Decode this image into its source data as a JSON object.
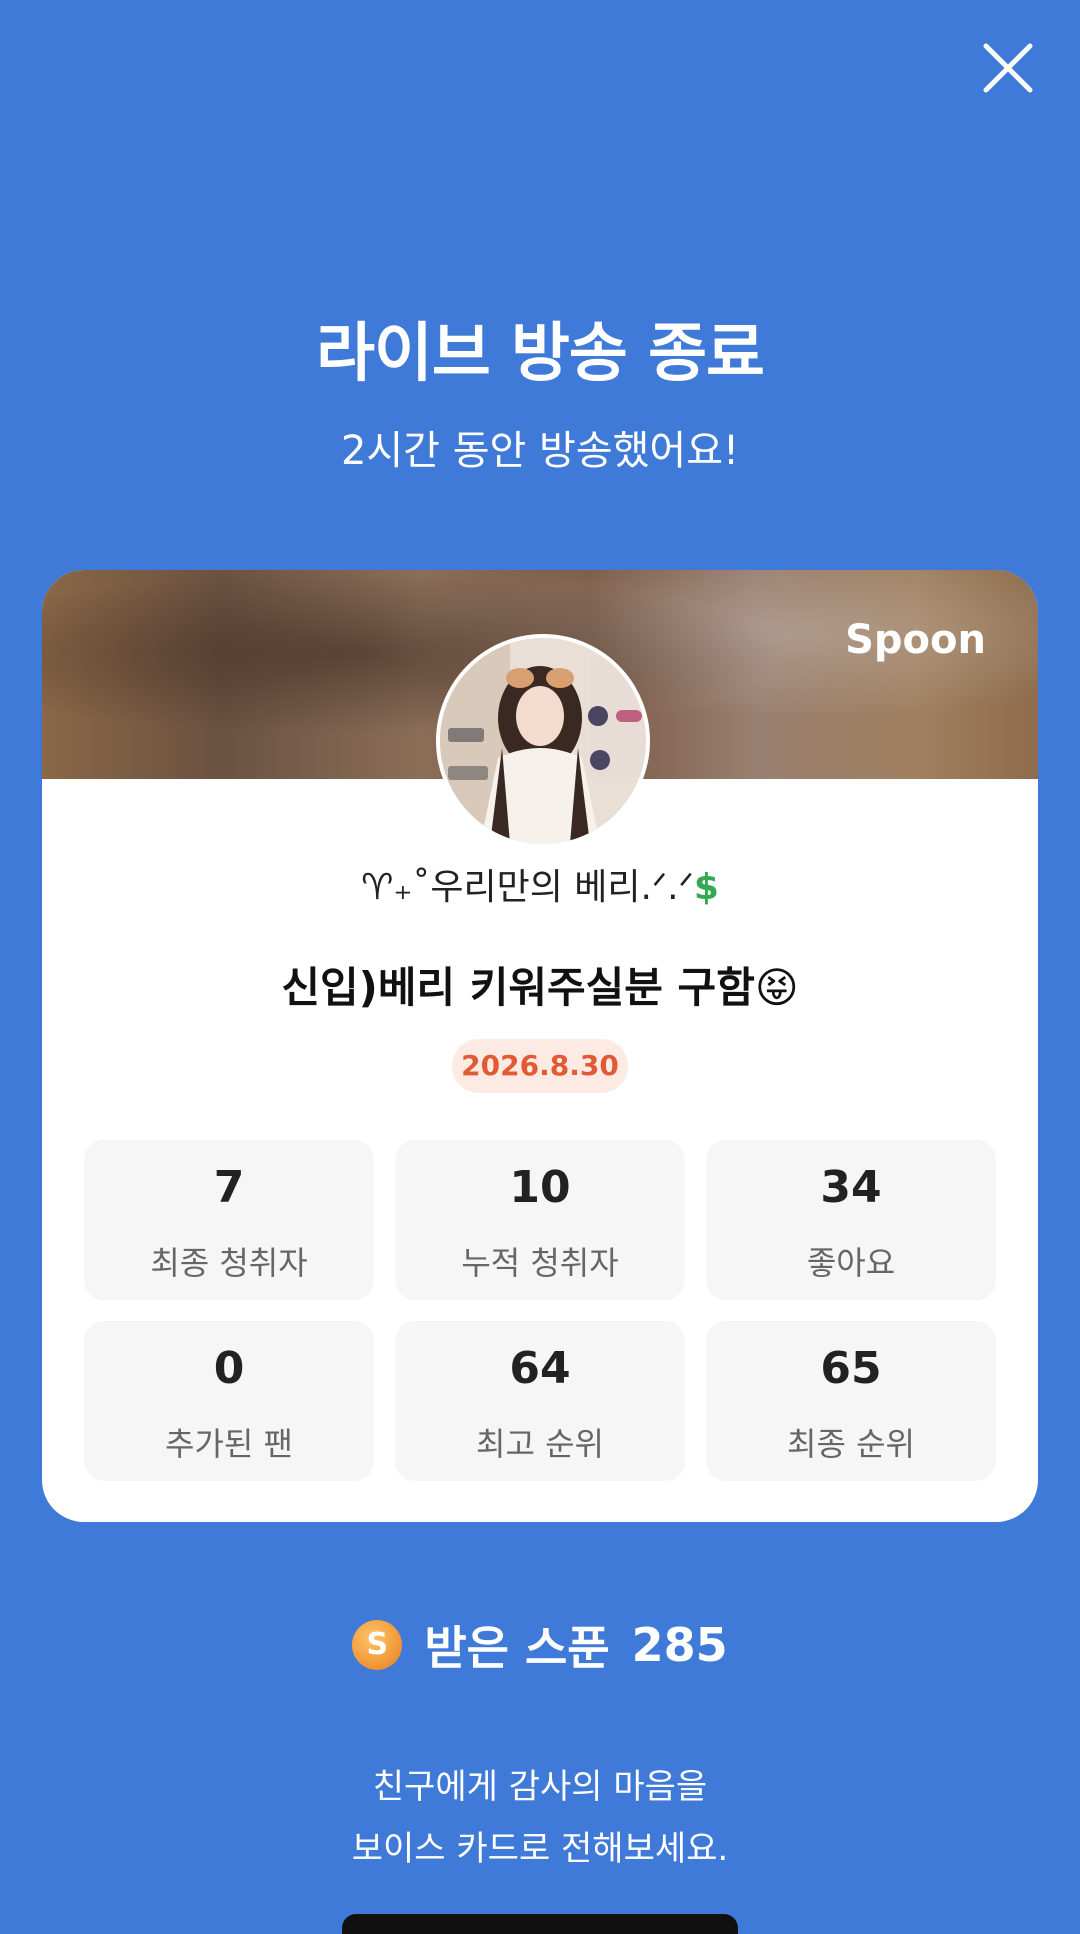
{
  "header": {
    "title": "라이브 방송 종료",
    "subtitle": "2시간 동안 방송했어요!"
  },
  "card": {
    "brand": "Spoon",
    "nickname_prefix": "♈₊˚우리만의 베리.ᐟ.ᐟ",
    "nickname_suffix": "$",
    "live_title": "신입)베리 키워주실분 구함😝",
    "date": "2026.8.30",
    "stats": [
      {
        "value": "7",
        "label": "최종 청취자"
      },
      {
        "value": "10",
        "label": "누적 청취자"
      },
      {
        "value": "34",
        "label": "좋아요"
      },
      {
        "value": "0",
        "label": "추가된 팬"
      },
      {
        "value": "64",
        "label": "최고 순위"
      },
      {
        "value": "65",
        "label": "최종 순위"
      }
    ]
  },
  "spoons": {
    "icon_letter": "S",
    "label": "받은 스푼",
    "count": "285"
  },
  "thanks": {
    "line1": "친구에게 감사의 마음을",
    "line2": "보이스 카드로 전해보세요."
  },
  "colors": {
    "background": "#407ad8",
    "date_badge_text": "#e15a34",
    "date_badge_bg": "#fdeae3"
  }
}
